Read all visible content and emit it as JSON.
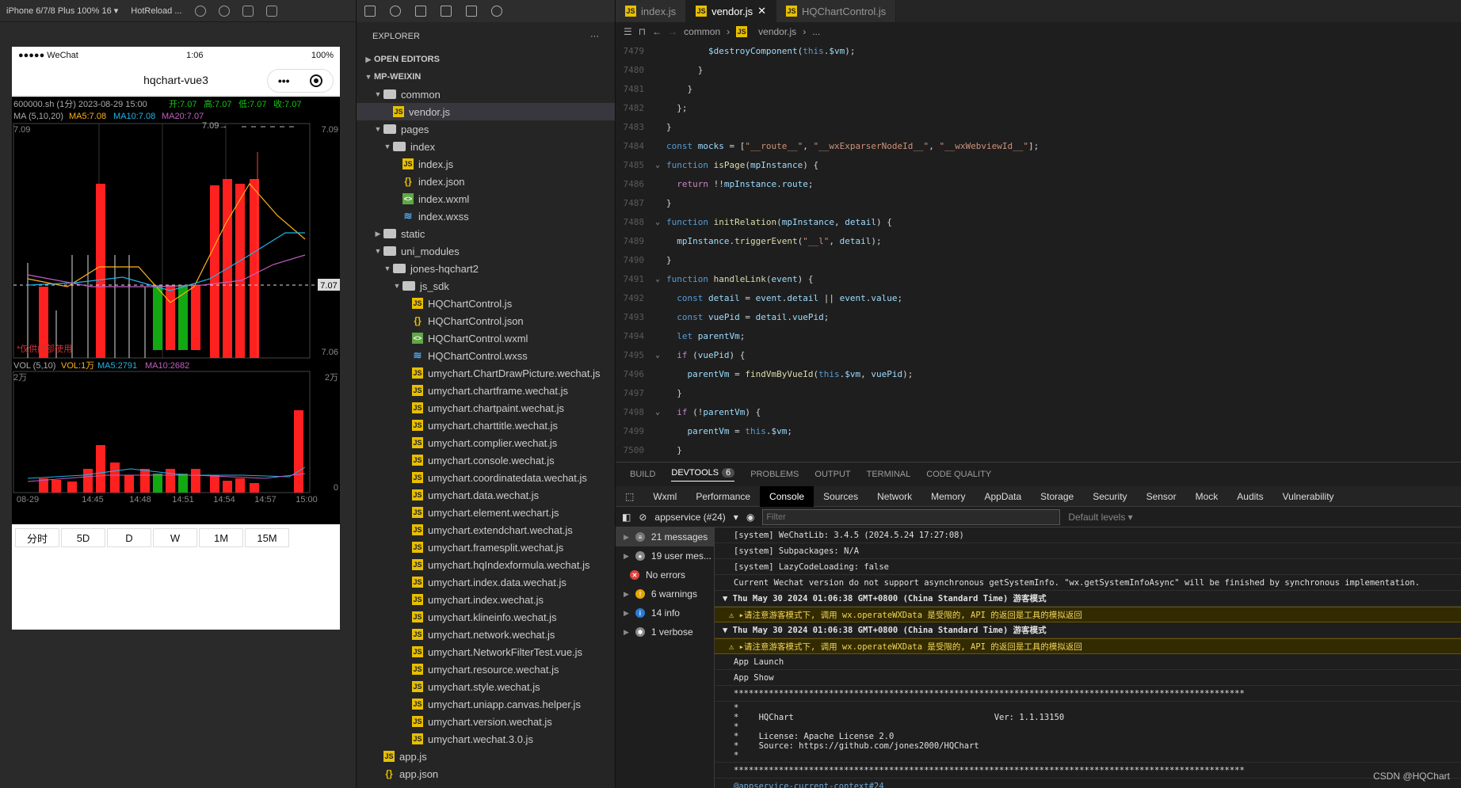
{
  "simulator": {
    "device": "iPhone 6/7/8 Plus 100% 16 ▾",
    "hotreload": "HotReload ...",
    "status": {
      "carrier": "●●●●● WeChat",
      "time": "1:06",
      "battery": "100%"
    },
    "nav_title": "hqchart-vue3",
    "chart": {
      "header": "600000.sh (1分) 2023-08-29 15:00",
      "open": "开:7.07",
      "high": "高:7.07",
      "low": "低:7.07",
      "close": "收:7.07",
      "ma_title": "MA (5,10,20)",
      "ma5": "MA5:7.08",
      "ma10": "MA10:7.08",
      "ma20": "MA20:7.07",
      "price_top": "7.09",
      "price_bottom": "7.06",
      "last_price": "7.07",
      "marker": "7.09→",
      "watermark": "*仅供内部使用",
      "vol_title": "VOL (5,10)",
      "vol": "VOL:1万",
      "vol_ma5": "MA5:2791",
      "vol_ma10": "MA10:2682",
      "vol_top": "2万",
      "vol_zero": "0",
      "x_labels": [
        "08-29",
        "14:45",
        "14:48",
        "14:51",
        "14:54",
        "14:57",
        "15:00"
      ],
      "colors": {
        "up": "#ff2020",
        "down": "#12a812",
        "ma5": "#ffb21a",
        "ma10": "#1fb4e8",
        "ma20": "#c060c0"
      }
    },
    "periods": [
      "分时",
      "5D",
      "D",
      "W",
      "1M",
      "15M"
    ]
  },
  "explorer": {
    "title": "EXPLORER",
    "more": "···",
    "open_editors": "OPEN EDITORS",
    "project": "MP-WEIXIN",
    "tree": [
      {
        "label": "common",
        "type": "folder",
        "depth": 1,
        "open": true
      },
      {
        "label": "vendor.js",
        "type": "js",
        "depth": 2,
        "selected": true
      },
      {
        "label": "pages",
        "type": "folder",
        "depth": 1,
        "open": true
      },
      {
        "label": "index",
        "type": "folder",
        "depth": 2,
        "open": true
      },
      {
        "label": "index.js",
        "type": "js",
        "depth": 3
      },
      {
        "label": "index.json",
        "type": "json",
        "depth": 3
      },
      {
        "label": "index.wxml",
        "type": "wxml",
        "depth": 3
      },
      {
        "label": "index.wxss",
        "type": "wxss",
        "depth": 3
      },
      {
        "label": "static",
        "type": "folder",
        "depth": 1,
        "open": false
      },
      {
        "label": "uni_modules",
        "type": "folder",
        "depth": 1,
        "open": true
      },
      {
        "label": "jones-hqchart2",
        "type": "folder",
        "depth": 2,
        "open": true
      },
      {
        "label": "js_sdk",
        "type": "folder",
        "depth": 3,
        "open": true
      },
      {
        "label": "HQChartControl.js",
        "type": "js",
        "depth": 4
      },
      {
        "label": "HQChartControl.json",
        "type": "json",
        "depth": 4
      },
      {
        "label": "HQChartControl.wxml",
        "type": "wxml",
        "depth": 4
      },
      {
        "label": "HQChartControl.wxss",
        "type": "wxss",
        "depth": 4
      },
      {
        "label": "umychart.ChartDrawPicture.wechat.js",
        "type": "js",
        "depth": 4
      },
      {
        "label": "umychart.chartframe.wechat.js",
        "type": "js",
        "depth": 4
      },
      {
        "label": "umychart.chartpaint.wechat.js",
        "type": "js",
        "depth": 4
      },
      {
        "label": "umychart.charttitle.wechat.js",
        "type": "js",
        "depth": 4
      },
      {
        "label": "umychart.complier.wechat.js",
        "type": "js",
        "depth": 4
      },
      {
        "label": "umychart.console.wechat.js",
        "type": "js",
        "depth": 4
      },
      {
        "label": "umychart.coordinatedata.wechat.js",
        "type": "js",
        "depth": 4
      },
      {
        "label": "umychart.data.wechat.js",
        "type": "js",
        "depth": 4
      },
      {
        "label": "umychart.element.wechart.js",
        "type": "js",
        "depth": 4
      },
      {
        "label": "umychart.extendchart.wechat.js",
        "type": "js",
        "depth": 4
      },
      {
        "label": "umychart.framesplit.wechat.js",
        "type": "js",
        "depth": 4
      },
      {
        "label": "umychart.hqIndexformula.wechat.js",
        "type": "js",
        "depth": 4
      },
      {
        "label": "umychart.index.data.wechat.js",
        "type": "js",
        "depth": 4
      },
      {
        "label": "umychart.index.wechat.js",
        "type": "js",
        "depth": 4
      },
      {
        "label": "umychart.klineinfo.wechat.js",
        "type": "js",
        "depth": 4
      },
      {
        "label": "umychart.network.wechat.js",
        "type": "js",
        "depth": 4
      },
      {
        "label": "umychart.NetworkFilterTest.vue.js",
        "type": "js",
        "depth": 4
      },
      {
        "label": "umychart.resource.wechat.js",
        "type": "js",
        "depth": 4
      },
      {
        "label": "umychart.style.wechat.js",
        "type": "js",
        "depth": 4
      },
      {
        "label": "umychart.uniapp.canvas.helper.js",
        "type": "js",
        "depth": 4
      },
      {
        "label": "umychart.version.wechat.js",
        "type": "js",
        "depth": 4
      },
      {
        "label": "umychart.wechat.3.0.js",
        "type": "js",
        "depth": 4
      },
      {
        "label": "app.js",
        "type": "js",
        "depth": 1
      },
      {
        "label": "app.json",
        "type": "json",
        "depth": 1
      }
    ]
  },
  "editor": {
    "tabs": [
      {
        "label": "index.js",
        "active": false
      },
      {
        "label": "vendor.js",
        "active": true
      },
      {
        "label": "HQChartControl.js",
        "active": false
      }
    ],
    "close_glyph": "✕",
    "breadcrumb": [
      "common",
      "vendor.js",
      "..."
    ],
    "lines": [
      {
        "n": "7479",
        "fold": "",
        "html": "        <span class='vr'>$destroyComponent</span>(<span class='kw'>this</span>.<span class='vr'>$vm</span>);"
      },
      {
        "n": "7480",
        "fold": "",
        "html": "      }"
      },
      {
        "n": "7481",
        "fold": "",
        "html": "    }"
      },
      {
        "n": "7482",
        "fold": "",
        "html": "  };"
      },
      {
        "n": "7483",
        "fold": "",
        "html": "}"
      },
      {
        "n": "7484",
        "fold": "",
        "html": "<span class='kw'>const</span> <span class='vr'>mocks</span> = [<span class='str'>\"__route__\"</span>, <span class='str'>\"__wxExparserNodeId__\"</span>, <span class='str'>\"__wxWebviewId__\"</span>];"
      },
      {
        "n": "7485",
        "fold": "⌄",
        "html": "<span class='kw'>function</span> <span class='fn'>isPage</span>(<span class='vr'>mpInstance</span>) {"
      },
      {
        "n": "7486",
        "fold": "",
        "html": "  <span class='ctl'>return</span> !!<span class='vr'>mpInstance</span>.<span class='vr'>route</span>;"
      },
      {
        "n": "7487",
        "fold": "",
        "html": "}"
      },
      {
        "n": "7488",
        "fold": "⌄",
        "html": "<span class='kw'>function</span> <span class='fn'>initRelation</span>(<span class='vr'>mpInstance</span>, <span class='vr'>detail</span>) {"
      },
      {
        "n": "7489",
        "fold": "",
        "html": "  <span class='vr'>mpInstance</span>.<span class='fn'>triggerEvent</span>(<span class='str'>\"__l\"</span>, <span class='vr'>detail</span>);"
      },
      {
        "n": "7490",
        "fold": "",
        "html": "}"
      },
      {
        "n": "7491",
        "fold": "⌄",
        "html": "<span class='kw'>function</span> <span class='fn'>handleLink</span>(<span class='vr'>event</span>) {"
      },
      {
        "n": "7492",
        "fold": "",
        "html": "  <span class='kw'>const</span> <span class='vr'>detail</span> = <span class='vr'>event</span>.<span class='vr'>detail</span> || <span class='vr'>event</span>.<span class='vr'>value</span>;"
      },
      {
        "n": "7493",
        "fold": "",
        "html": "  <span class='kw'>const</span> <span class='vr'>vuePid</span> = <span class='vr'>detail</span>.<span class='vr'>vuePid</span>;"
      },
      {
        "n": "7494",
        "fold": "",
        "html": "  <span class='kw'>let</span> <span class='vr'>parentVm</span>;"
      },
      {
        "n": "7495",
        "fold": "⌄",
        "html": "  <span class='ctl'>if</span> (<span class='vr'>vuePid</span>) {"
      },
      {
        "n": "7496",
        "fold": "",
        "html": "    <span class='vr'>parentVm</span> = <span class='fn'>findVmByVueId</span>(<span class='kw'>this</span>.<span class='vr'>$vm</span>, <span class='vr'>vuePid</span>);"
      },
      {
        "n": "7497",
        "fold": "",
        "html": "  }"
      },
      {
        "n": "7498",
        "fold": "⌄",
        "html": "  <span class='ctl'>if</span> (!<span class='vr'>parentVm</span>) {"
      },
      {
        "n": "7499",
        "fold": "",
        "html": "    <span class='vr'>parentVm</span> = <span class='kw'>this</span>.<span class='vr'>$vm</span>;"
      },
      {
        "n": "7500",
        "fold": "",
        "html": "  }"
      }
    ]
  },
  "panel": {
    "tabs": [
      "BUILD",
      "DEVTOOLS",
      "PROBLEMS",
      "OUTPUT",
      "TERMINAL",
      "CODE QUALITY"
    ],
    "devtools_badge": "6",
    "dev_tabs": [
      "Wxml",
      "Performance",
      "Console",
      "Sources",
      "Network",
      "Memory",
      "AppData",
      "Storage",
      "Security",
      "Sensor",
      "Mock",
      "Audits",
      "Vulnerability"
    ],
    "context": "appservice (#24)",
    "filter_placeholder": "Filter",
    "levels": "Default levels ▾",
    "sidebar": [
      {
        "label": "21 messages",
        "icon": "≡",
        "color": "#777"
      },
      {
        "label": "19 user mes...",
        "icon": "●",
        "color": "#888"
      },
      {
        "label": "No errors",
        "icon": "✕",
        "color": "#e0443e"
      },
      {
        "label": "6 warnings",
        "icon": "!",
        "color": "#e6a700"
      },
      {
        "label": "14 info",
        "icon": "i",
        "color": "#2a7bd8"
      },
      {
        "label": "1 verbose",
        "icon": "✱",
        "color": "#888"
      }
    ],
    "logs": [
      {
        "cls": "",
        "text": "[system] WeChatLib: 3.4.5 (2024.5.24 17:27:08)"
      },
      {
        "cls": "",
        "text": "[system] Subpackages: N/A"
      },
      {
        "cls": "",
        "text": "[system] LazyCodeLoading: false"
      },
      {
        "cls": "",
        "text": "Current Wechat version do not support asynchronous getSystemInfo. \"wx.getSystemInfoAsync\" will be finished by synchronous implementation."
      },
      {
        "cls": "group",
        "text": "▼ Thu May 30 2024 01:06:38 GMT+0800 (China Standard Time) 游客模式"
      },
      {
        "cls": "warn",
        "text": "⚠ ▸请注意游客模式下, 调用 wx.operateWXData 是受限的, API 的返回是工具的模拟返回"
      },
      {
        "cls": "group",
        "text": "▼ Thu May 30 2024 01:06:38 GMT+0800 (China Standard Time) 游客模式"
      },
      {
        "cls": "warn",
        "text": "⚠ ▸请注意游客模式下, 调用 wx.operateWXData 是受限的, API 的返回是工具的模拟返回"
      },
      {
        "cls": "",
        "text": "App Launch"
      },
      {
        "cls": "",
        "text": "App Show"
      },
      {
        "cls": "",
        "text": "******************************************************************************************************"
      },
      {
        "cls": "",
        "text": "*\n*    HQChart                                        Ver: 1.1.13150\n*\n*    License: Apache License 2.0\n*    Source: https://github.com/jones2000/HQChart\n*"
      },
      {
        "cls": "",
        "text": "******************************************************************************************************"
      },
      {
        "cls": "link",
        "text": "@appservice-current-context#24"
      }
    ]
  },
  "watermark": "CSDN @HQChart"
}
